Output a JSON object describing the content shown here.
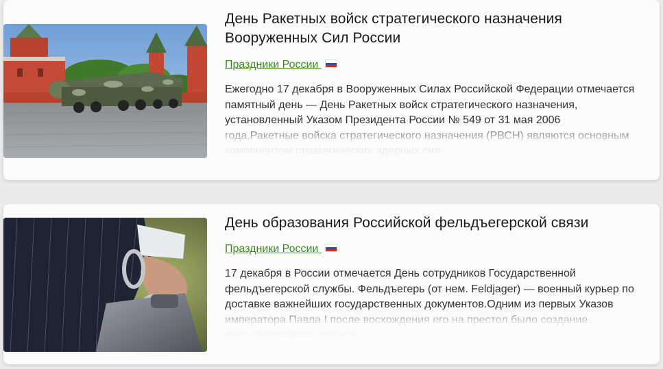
{
  "articles": [
    {
      "title": "День Ракетных войск стратегического назначения Вооруженных Сил России",
      "category": "Праздники России",
      "flag_icon": "russia-flag-icon",
      "excerpt": "Ежегодно 17 декабря в Вооруженных Силах Российской Федерации отмечается памятный день — День Ракетных войск стратегического назначения, установленный Указом Президента России № 549 от 31 мая 2006 года.Ракетные войска стратегического назначения (РВСН) являются основным компонентом стратегических ядерных сил",
      "image": "missile-parade-kremlin-photo"
    },
    {
      "title": "День образования Российской фельдъегерской связи",
      "category": "Праздники России",
      "flag_icon": "russia-flag-icon",
      "excerpt": "17 декабря в России отмечается День сотрудников Государственной фельдъегерской службы. Фельдъегерь (от нем. Feldjager) — военный курьер по доставке важнейших государственных документов.Одним из первых Указов императора Павла I после восхождения его на престол было создание Фельдъегерского корпуса",
      "image": "courier-handcuffed-briefcase-photo"
    }
  ],
  "colors": {
    "link": "#3a8a1d",
    "title": "#1a1a1a",
    "text": "#333333",
    "card_bg": "#fbfbfb",
    "page_bg": "#ebebeb"
  }
}
